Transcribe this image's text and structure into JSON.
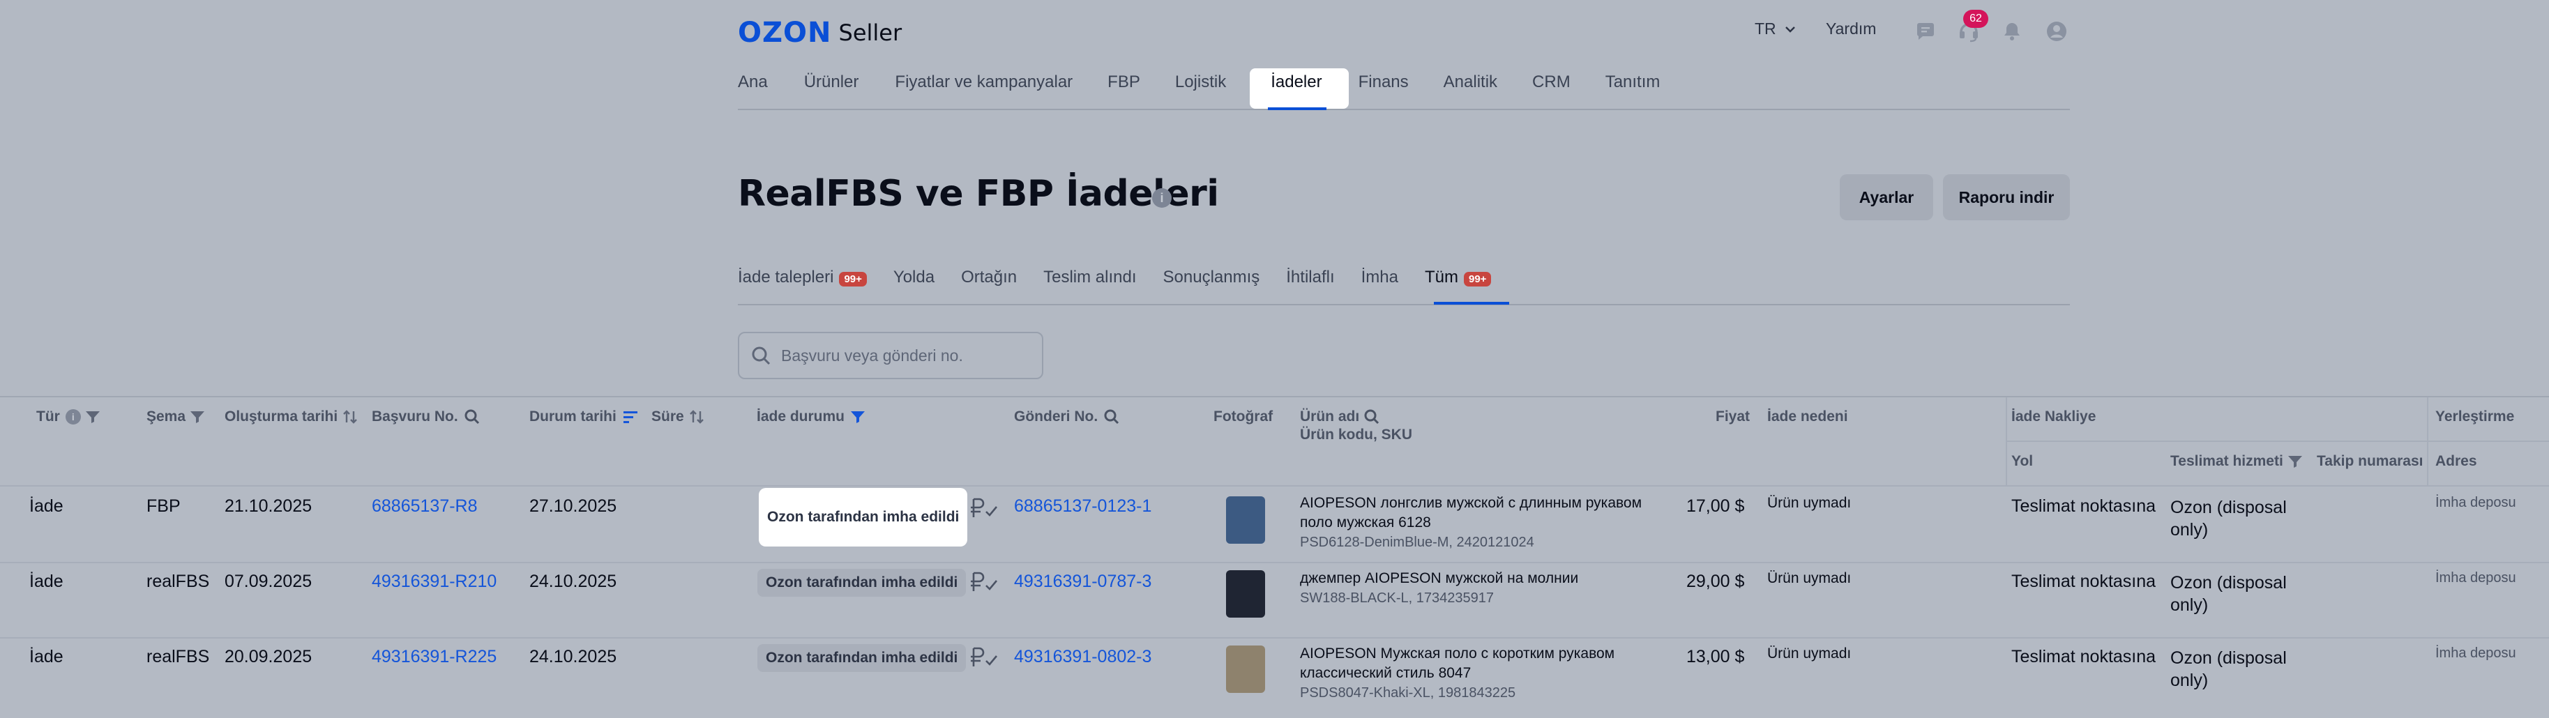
{
  "header": {
    "logo_brand": "OZON",
    "logo_product": "Seller",
    "language": "TR",
    "help": "Yardım",
    "notification_count": "62"
  },
  "nav": {
    "items": [
      {
        "label": "Ana"
      },
      {
        "label": "Ürünler"
      },
      {
        "label": "Fiyatlar ve kampanyalar"
      },
      {
        "label": "FBP"
      },
      {
        "label": "Lojistik"
      },
      {
        "label": "İadeler",
        "active": true
      },
      {
        "label": "Finans"
      },
      {
        "label": "Analitik"
      },
      {
        "label": "CRM"
      },
      {
        "label": "Tanıtım"
      }
    ]
  },
  "page": {
    "title": "RealFBS ve FBP İadeleri",
    "settings_button": "Ayarlar",
    "download_button": "Raporu indir"
  },
  "tabs": [
    {
      "label": "İade talepleri",
      "badge": "99+"
    },
    {
      "label": "Yolda"
    },
    {
      "label": "Ortağın"
    },
    {
      "label": "Teslim alındı"
    },
    {
      "label": "Sonuçlanmış"
    },
    {
      "label": "İhtilaflı"
    },
    {
      "label": "İmha"
    },
    {
      "label": "Tüm",
      "badge": "99+",
      "active": true
    }
  ],
  "search": {
    "placeholder": "Başvuru veya gönderi no."
  },
  "table": {
    "headers": {
      "type": "Tür",
      "scheme": "Şema",
      "created": "Oluşturma tarihi",
      "application": "Başvuru No.",
      "status_date": "Durum tarihi",
      "duration": "Süre",
      "return_status": "İade durumu",
      "shipment": "Gönderi No.",
      "photo": "Fotoğraf",
      "product_name": "Ürün adı",
      "product_code": "Ürün kodu, SKU",
      "price": "Fiyat",
      "reason": "İade nedeni",
      "return_shipping": "İade Nakliye",
      "route": "Yol",
      "delivery_service": "Teslimat hizmeti",
      "tracking": "Takip numarası",
      "placement": "Yerleştirme",
      "address": "Adres"
    },
    "rows": [
      {
        "type": "İade",
        "scheme": "FBP",
        "created": "21.10.2025",
        "application": "68865137-R8",
        "status_date": "27.10.2025",
        "status": "Ozon tarafından imha edildi",
        "shipment": "68865137-0123-1",
        "product_title": "AIOPESON лонгслив мужской с длинным рукавом поло мужская 6128",
        "product_sku": "PSD6128-DenimBlue-M, 2420121024",
        "price": "17,00 $",
        "reason": "Ürün uymadı",
        "route": "Teslimat noktasına",
        "service": "Ozon (disposal only)",
        "address": "İmha deposu",
        "photo_color": "#3c5a82"
      },
      {
        "type": "İade",
        "scheme": "realFBS",
        "created": "07.09.2025",
        "application": "49316391-R210",
        "status_date": "24.10.2025",
        "status": "Ozon tarafından imha edildi",
        "shipment": "49316391-0787-3",
        "product_title": "джемпер AIOPESON мужской на молнии",
        "product_sku": "SW188-BLACK-L, 1734235917",
        "price": "29,00 $",
        "reason": "Ürün uymadı",
        "route": "Teslimat noktasına",
        "service": "Ozon (disposal only)",
        "address": "İmha deposu",
        "photo_color": "#1f2533"
      },
      {
        "type": "İade",
        "scheme": "realFBS",
        "created": "20.09.2025",
        "application": "49316391-R225",
        "status_date": "24.10.2025",
        "status": "Ozon tarafından imha edildi",
        "shipment": "49316391-0802-3",
        "product_title": "AIOPESON Мужская поло с коротким рукавом классический стиль 8047",
        "product_sku": "PSDS8047-Khaki-XL, 1981843225",
        "price": "13,00 $",
        "reason": "Ürün uymadı",
        "route": "Teslimat noktasına",
        "service": "Ozon (disposal only)",
        "address": "İmha deposu",
        "photo_color": "#8e826d"
      }
    ]
  }
}
